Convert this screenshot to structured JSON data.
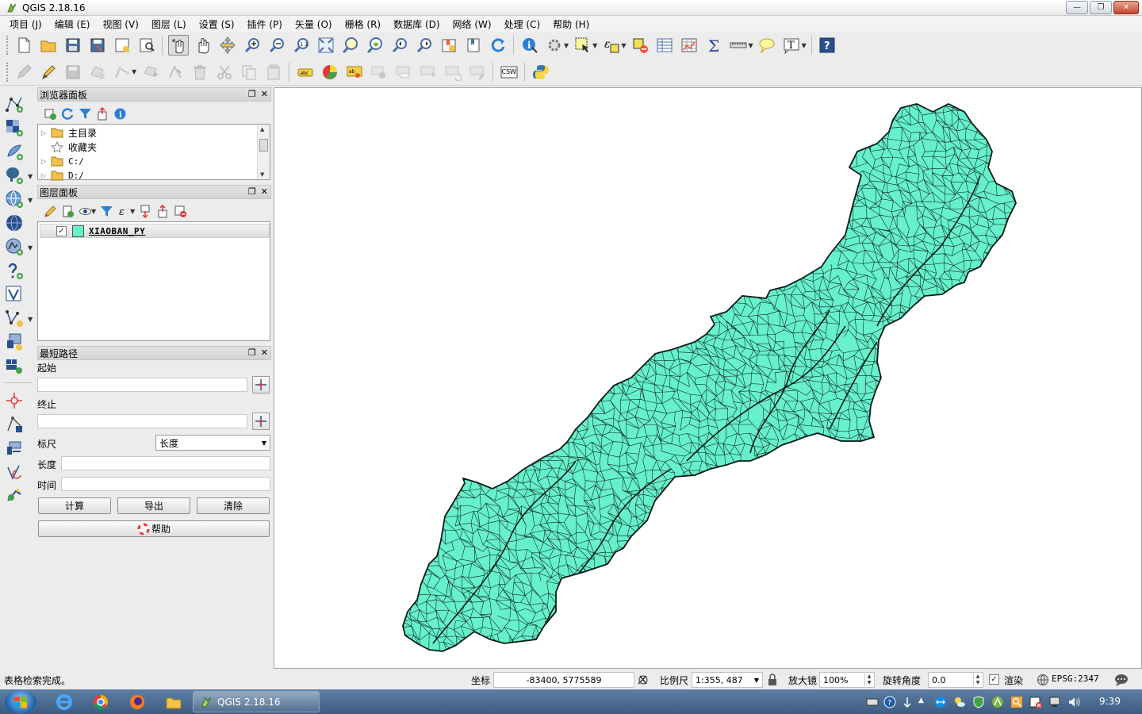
{
  "window": {
    "title": "QGIS 2.18.16"
  },
  "menu": [
    "项目 (J)",
    "编辑 (E)",
    "视图 (V)",
    "图层 (L)",
    "设置 (S)",
    "插件 (P)",
    "矢量 (O)",
    "栅格 (R)",
    "数据库 (D)",
    "网络 (W)",
    "处理 (C)",
    "帮助 (H)"
  ],
  "browser": {
    "title": "浏览器面板",
    "items": [
      "主目录",
      "收藏夹",
      "C:/",
      "D:/"
    ]
  },
  "layers": {
    "title": "图层面板",
    "items": [
      {
        "name": "XIAOBAN_PY",
        "checked": true,
        "color": "#66f0cc"
      }
    ]
  },
  "shortest_path": {
    "title": "最短路径",
    "start_label": "起始",
    "end_label": "终止",
    "criterion_label": "标尺",
    "criterion_value": "长度",
    "length_label": "长度",
    "time_label": "时间",
    "calc_button": "计算",
    "export_button": "导出",
    "clear_button": "清除",
    "help_button": "帮助"
  },
  "toolbar2": {
    "csw_label": "CSW"
  },
  "status": {
    "message": "表格检索完成。",
    "coord_label": "坐标",
    "coord_value": "-83400, 5775589",
    "scale_label": "比例尺",
    "scale_value": "1:355, 487",
    "magnifier_label": "放大镜",
    "magnifier_value": "100%",
    "rotation_label": "旋转角度",
    "rotation_value": "0.0",
    "render_label": "渲染",
    "crs": "EPSG:2347"
  },
  "taskbar": {
    "task_label": "QGIS 2.18.16",
    "clock": "9:39"
  },
  "colors": {
    "fill": "#66f0cc",
    "outline": "#0a1a14"
  }
}
